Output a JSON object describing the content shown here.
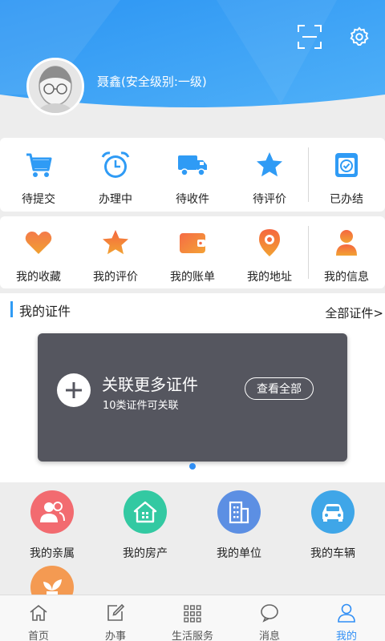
{
  "header": {
    "username": "聂鑫(安全级别:一级)",
    "colors": {
      "primary": "#2f9bf5",
      "light": "#7cc3fb"
    }
  },
  "orders": [
    {
      "label": "待提交",
      "icon": "cart-icon"
    },
    {
      "label": "办理中",
      "icon": "alarm-clock-icon"
    },
    {
      "label": "待收件",
      "icon": "truck-icon"
    },
    {
      "label": "待评价",
      "icon": "star-icon"
    },
    {
      "label": "已办结",
      "icon": "check-box-icon"
    }
  ],
  "personal": [
    {
      "label": "我的收藏",
      "icon": "heart-icon"
    },
    {
      "label": "我的评价",
      "icon": "star-icon"
    },
    {
      "label": "我的账单",
      "icon": "wallet-icon"
    },
    {
      "label": "我的地址",
      "icon": "location-pin-icon"
    },
    {
      "label": "我的信息",
      "icon": "person-icon"
    }
  ],
  "certificates": {
    "title": "我的证件",
    "all_link": "全部证件>",
    "card_title": "关联更多证件",
    "card_subtitle": "10类证件可关联",
    "view_all_button": "查看全部"
  },
  "family": [
    {
      "label": "我的亲属",
      "icon": "relatives-icon",
      "color": "#f26b70"
    },
    {
      "label": "我的房产",
      "icon": "house-icon",
      "color": "#33c9a2"
    },
    {
      "label": "我的单位",
      "icon": "building-icon",
      "color": "#5c8fe3"
    },
    {
      "label": "我的车辆",
      "icon": "car-icon",
      "color": "#3fa6e8"
    },
    {
      "label": "",
      "icon": "plant-icon",
      "color": "#f49a52"
    }
  ],
  "tabs": [
    {
      "label": "首页",
      "icon": "home-icon",
      "active": false
    },
    {
      "label": "办事",
      "icon": "edit-icon",
      "active": false
    },
    {
      "label": "生活服务",
      "icon": "grid-icon",
      "active": false
    },
    {
      "label": "消息",
      "icon": "chat-icon",
      "active": false
    },
    {
      "label": "我的",
      "icon": "person-icon",
      "active": true
    }
  ]
}
